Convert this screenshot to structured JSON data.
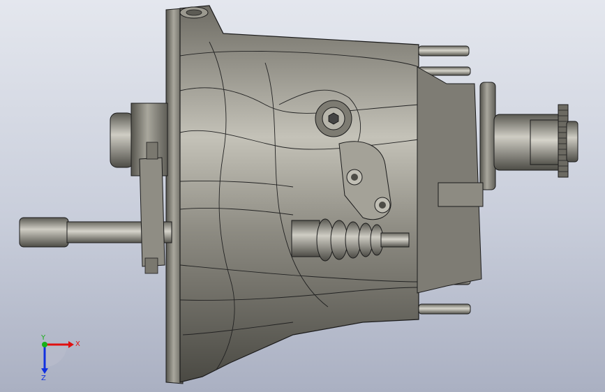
{
  "viewport": {
    "background_top": "#e4e7ee",
    "background_bottom": "#aab0c2"
  },
  "model": {
    "body_color": "#8c8a80",
    "edge_color": "#1b1b1b"
  },
  "triad": {
    "x_label": "X",
    "y_label": "Y",
    "z_label": "Z",
    "x_color": "#e01010",
    "y_color": "#18b018",
    "z_color": "#1030e0"
  }
}
